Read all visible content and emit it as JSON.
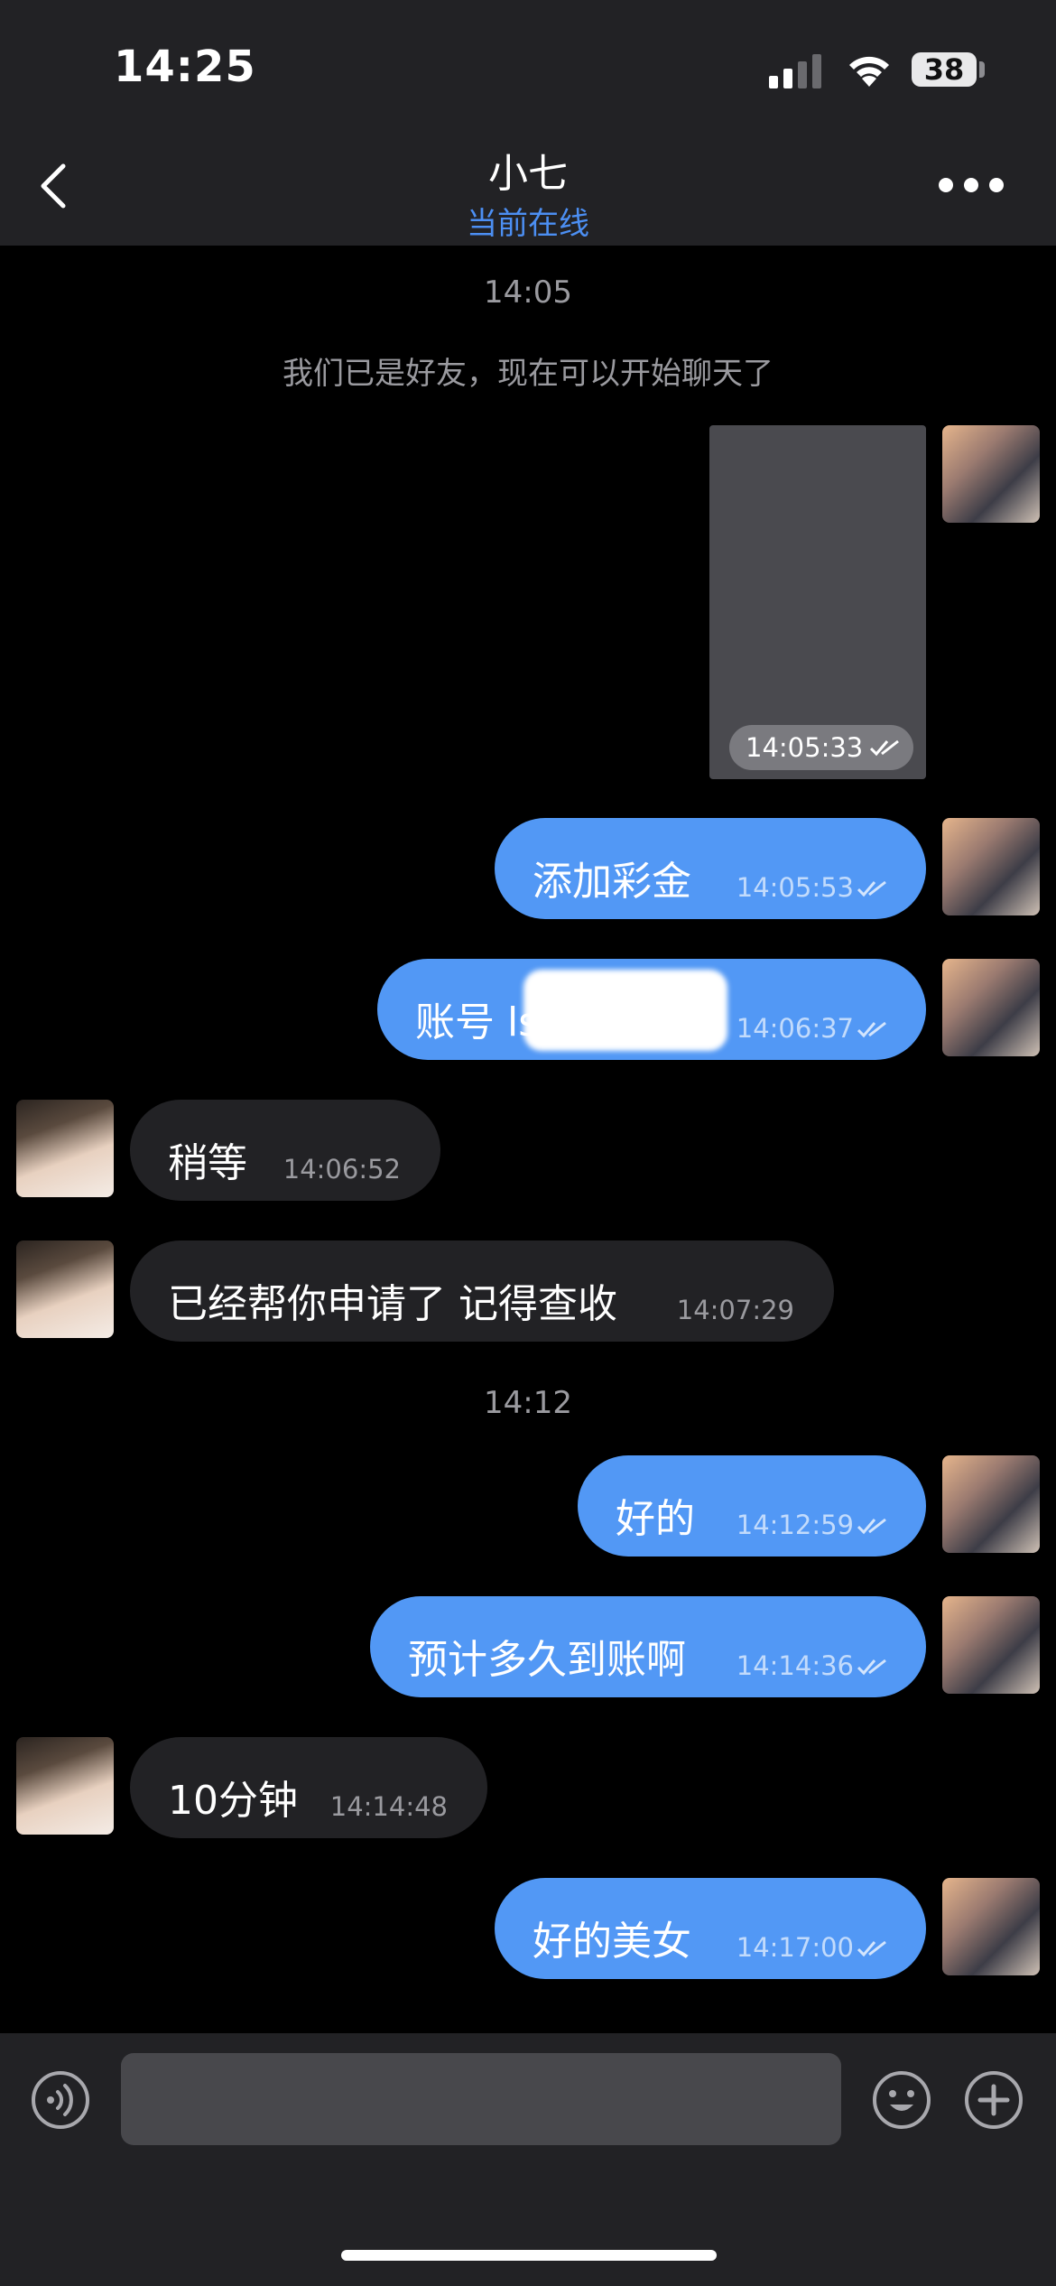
{
  "status_bar": {
    "time": "14:25",
    "battery": "38"
  },
  "header": {
    "contact_name": "小七",
    "online_status": "当前在线"
  },
  "chat": {
    "time_separators": [
      "14:05",
      "14:12"
    ],
    "system_notice": "我们已是好友，现在可以开始聊天了",
    "image_message_time": "14:05:33",
    "messages": [
      {
        "direction": "out",
        "text": "添加彩金",
        "time": "14:05:53"
      },
      {
        "direction": "out",
        "text": "账号 ls",
        "time": "14:06:37"
      },
      {
        "direction": "in",
        "text": "稍等",
        "time": "14:06:52"
      },
      {
        "direction": "in",
        "text": "已经帮你申请了  记得查收",
        "time": "14:07:29"
      },
      {
        "direction": "out",
        "text": "好的",
        "time": "14:12:59"
      },
      {
        "direction": "out",
        "text": "预计多久到账啊",
        "time": "14:14:36"
      },
      {
        "direction": "in",
        "text": "10分钟",
        "time": "14:14:48"
      },
      {
        "direction": "out",
        "text": "好的美女",
        "time": "14:17:00"
      }
    ]
  },
  "input_bar": {
    "placeholder": ""
  },
  "icons": [
    "back-icon",
    "more-icon",
    "signal-icon",
    "wifi-icon",
    "battery-icon",
    "voice-icon",
    "emoji-icon",
    "plus-icon",
    "read-check-icon"
  ],
  "colors": {
    "outgoing_bubble": "#5298f5",
    "incoming_bubble": "#222225",
    "online_status": "#4c8ff3",
    "background": "#000000"
  }
}
